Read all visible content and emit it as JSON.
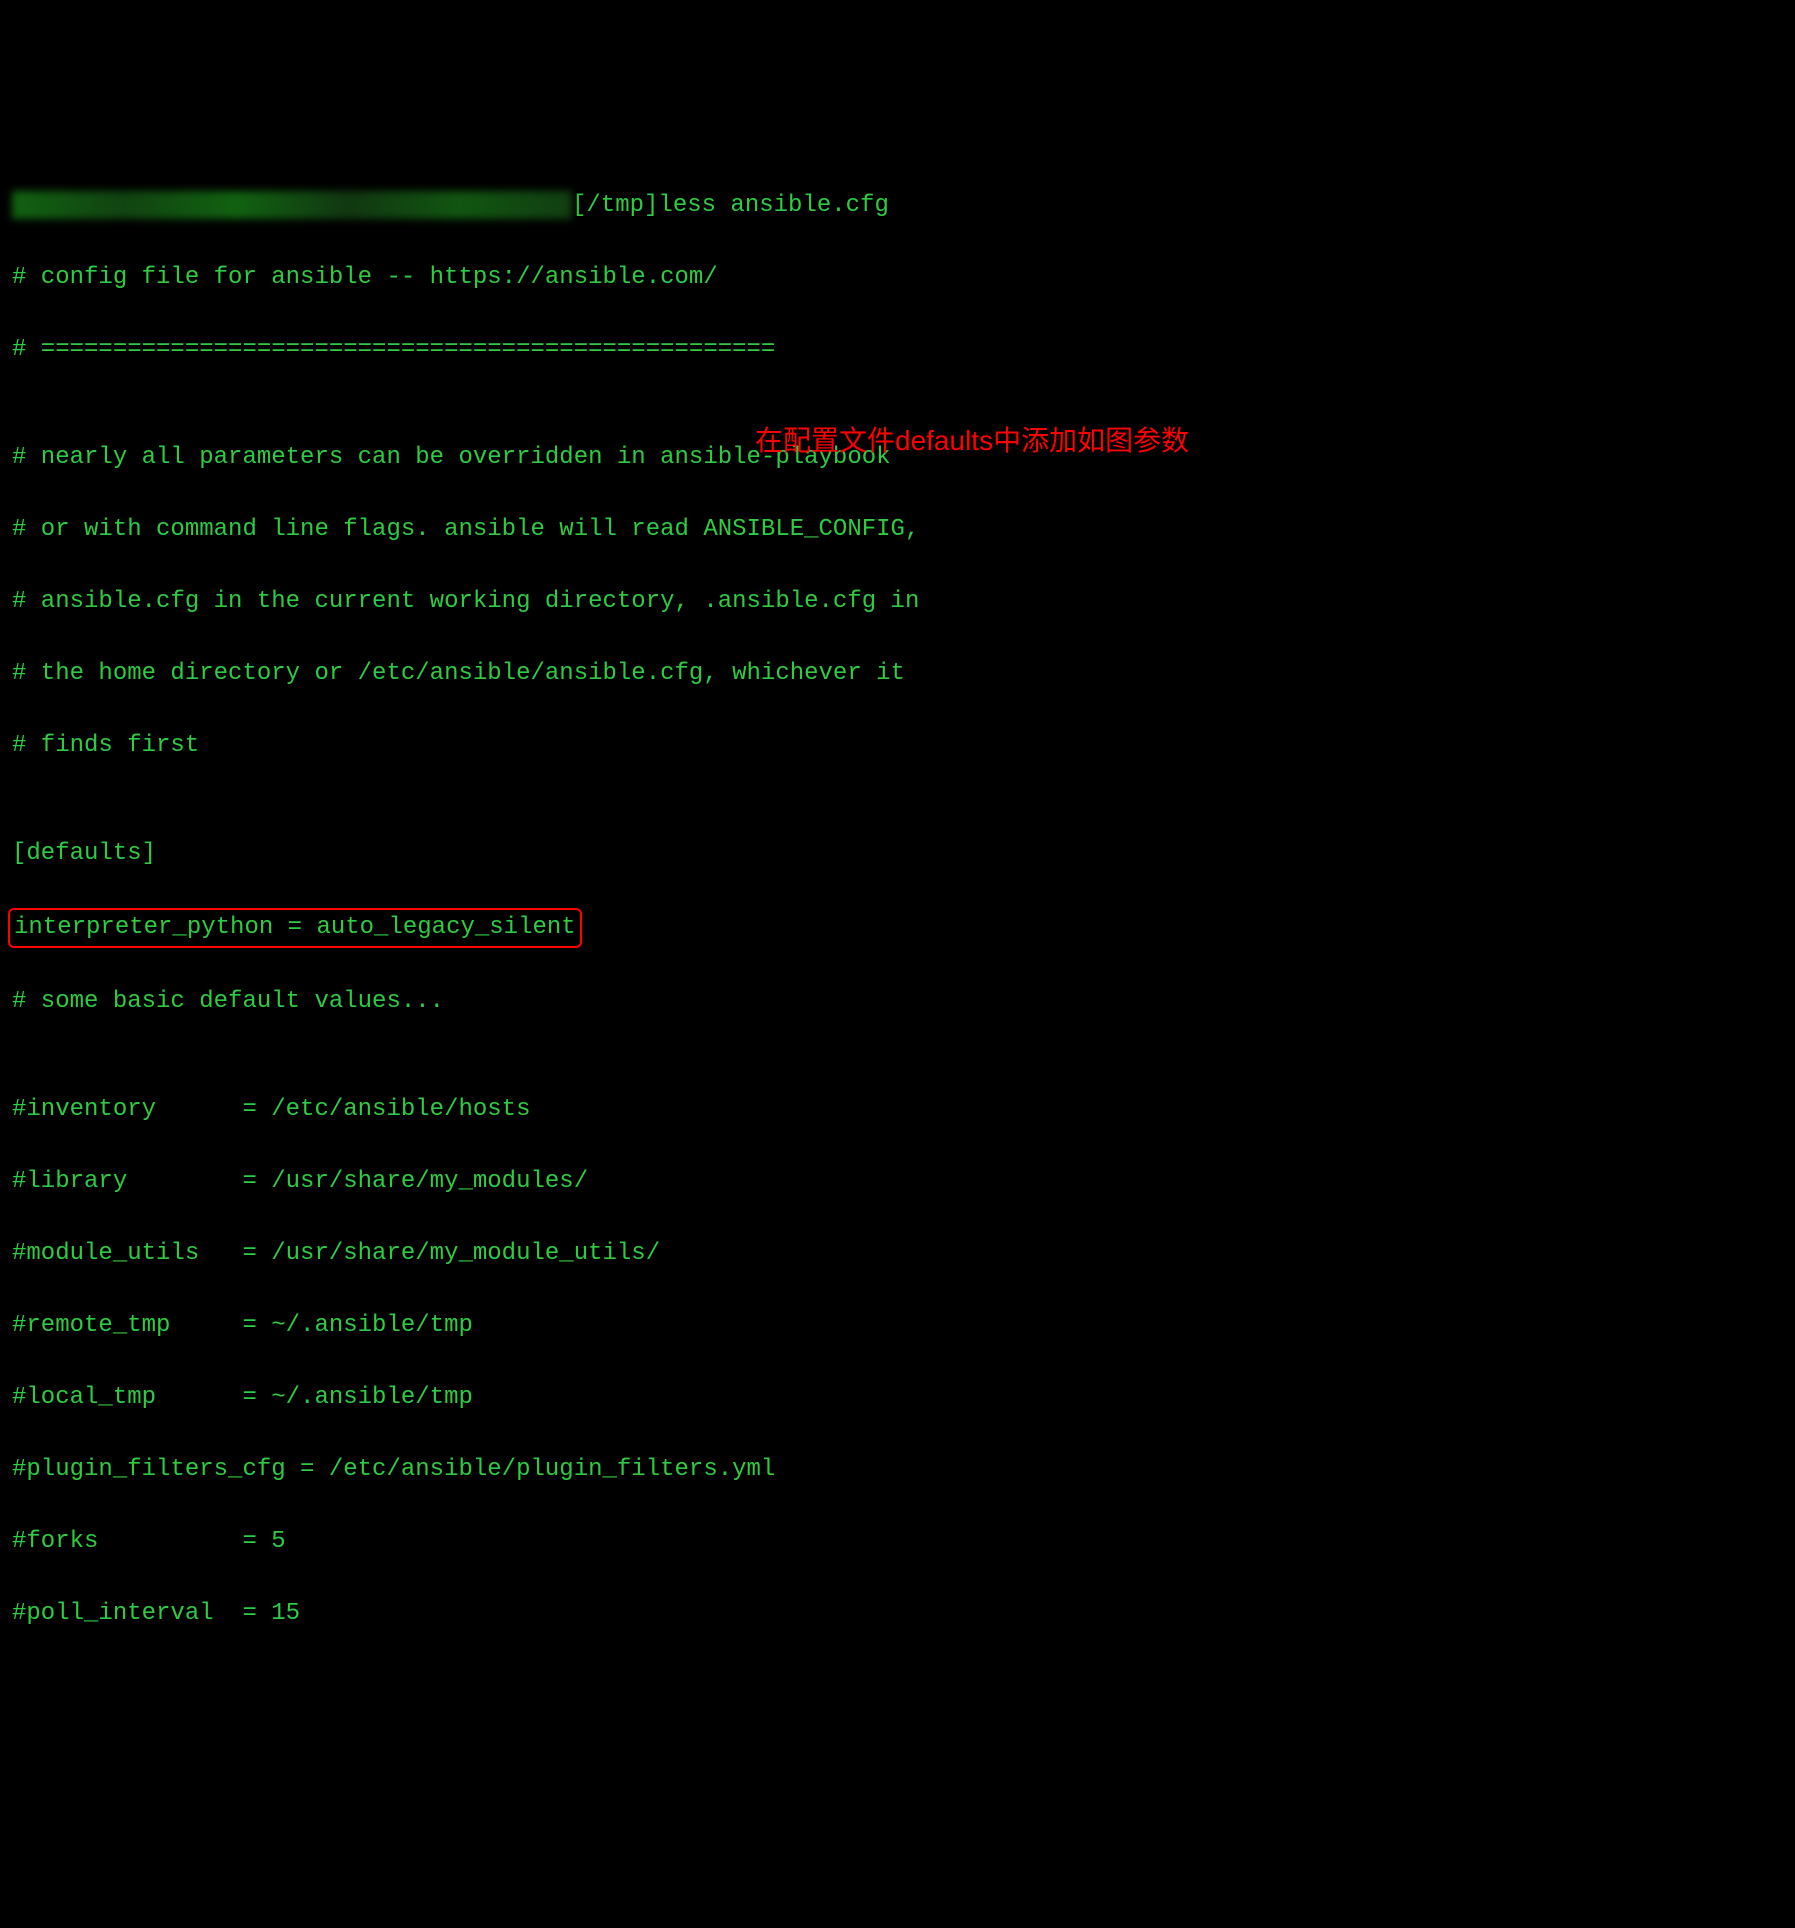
{
  "prompt": {
    "path_cmd": "[/tmp]less ansible.cfg"
  },
  "lines": {
    "l1": "# config file for ansible -- https://ansible.com/",
    "l2": "# ===================================================",
    "l3": "",
    "l4": "# nearly all parameters can be overridden in ansible-playbook",
    "l5": "# or with command line flags. ansible will read ANSIBLE_CONFIG,",
    "l6": "# ansible.cfg in the current working directory, .ansible.cfg in",
    "l7": "# the home directory or /etc/ansible/ansible.cfg, whichever it",
    "l8": "# finds first",
    "l9": "",
    "l10": "[defaults]",
    "l11": "interpreter_python = auto_legacy_silent",
    "l12": "# some basic default values...",
    "l13": "",
    "l14": "#inventory      = /etc/ansible/hosts",
    "l15": "#library        = /usr/share/my_modules/",
    "l16": "#module_utils   = /usr/share/my_module_utils/",
    "l17": "#remote_tmp     = ~/.ansible/tmp",
    "l18": "#local_tmp      = ~/.ansible/tmp",
    "l19": "#plugin_filters_cfg = /etc/ansible/plugin_filters.yml",
    "l20": "#forks          = 5",
    "l21": "#poll_interval  = 15"
  },
  "annotation": {
    "text": "在配置文件defaults中添加如图参数"
  }
}
